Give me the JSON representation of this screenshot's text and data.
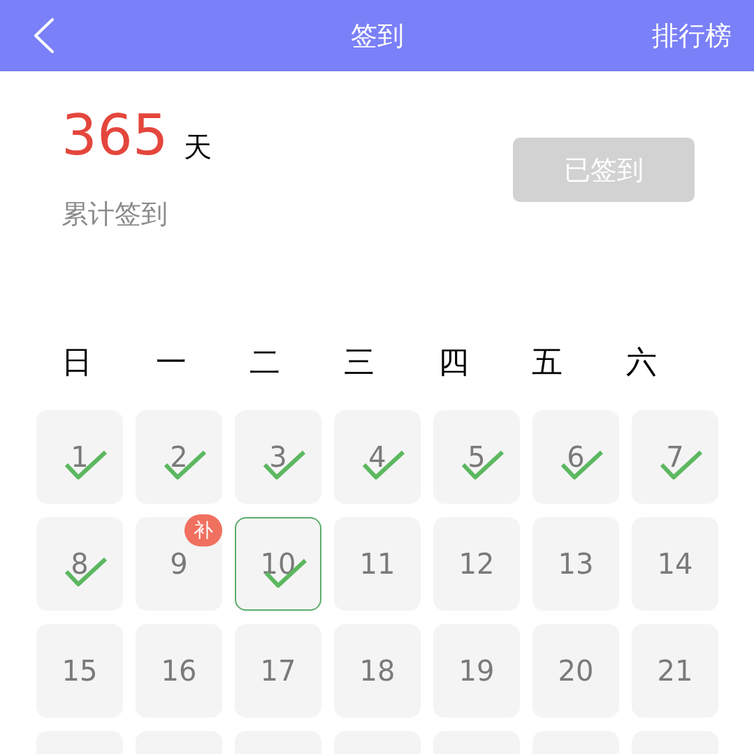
{
  "header": {
    "title": "签到",
    "right_link": "排行榜"
  },
  "summary": {
    "count": "365",
    "unit": "天",
    "label": "累计签到",
    "button": {
      "label": "已签到",
      "disabled": true
    }
  },
  "weekdays": [
    "日",
    "一",
    "二",
    "三",
    "四",
    "五",
    "六"
  ],
  "days": [
    {
      "day": "1",
      "checked": true,
      "selected": false
    },
    {
      "day": "2",
      "checked": true,
      "selected": false
    },
    {
      "day": "3",
      "checked": true,
      "selected": false
    },
    {
      "day": "4",
      "checked": true,
      "selected": false
    },
    {
      "day": "5",
      "checked": true,
      "selected": false
    },
    {
      "day": "6",
      "checked": true,
      "selected": false
    },
    {
      "day": "7",
      "checked": true,
      "selected": false
    },
    {
      "day": "8",
      "checked": true,
      "selected": false
    },
    {
      "day": "9",
      "checked": false,
      "selected": false,
      "badge": "补"
    },
    {
      "day": "10",
      "checked": true,
      "selected": true
    },
    {
      "day": "11",
      "checked": false,
      "selected": false
    },
    {
      "day": "12",
      "checked": false,
      "selected": false
    },
    {
      "day": "13",
      "checked": false,
      "selected": false
    },
    {
      "day": "14",
      "checked": false,
      "selected": false
    },
    {
      "day": "15",
      "checked": false,
      "selected": false
    },
    {
      "day": "16",
      "checked": false,
      "selected": false
    },
    {
      "day": "17",
      "checked": false,
      "selected": false
    },
    {
      "day": "18",
      "checked": false,
      "selected": false
    },
    {
      "day": "19",
      "checked": false,
      "selected": false
    },
    {
      "day": "20",
      "checked": false,
      "selected": false
    },
    {
      "day": "21",
      "checked": false,
      "selected": false
    },
    {
      "checked": false,
      "selected": false
    },
    {
      "checked": false,
      "selected": false
    },
    {
      "checked": false,
      "selected": false
    },
    {
      "checked": false,
      "selected": false
    },
    {
      "checked": false,
      "selected": false
    },
    {
      "checked": false,
      "selected": false
    },
    {
      "checked": false,
      "selected": false
    }
  ]
}
